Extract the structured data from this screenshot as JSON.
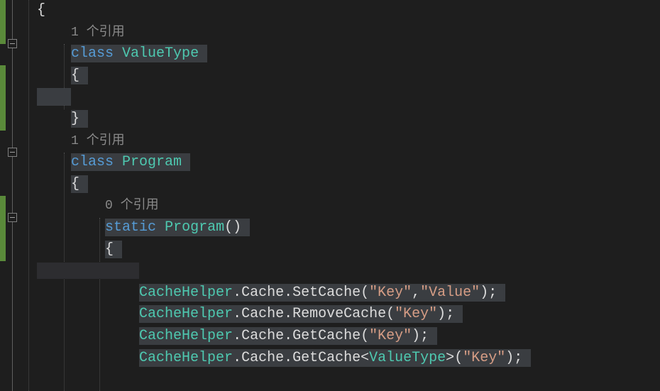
{
  "codelens": {
    "ref1": "1 个引用",
    "ref1b": "1 个引用",
    "ref0": "0 个引用"
  },
  "code": {
    "brace_open": "{",
    "brace_close": "}",
    "class_kw": "class",
    "static_kw": "static",
    "valuetype": "ValueType",
    "program": "Program",
    "paren": "()",
    "cachehelper": "CacheHelper",
    "dot": ".",
    "cache_prop": "Cache",
    "setcache": "SetCache",
    "removecache": "RemoveCache",
    "getcache": "GetCache",
    "key_str": "\"Key\"",
    "value_str": "\"Value\"",
    "comma": ",",
    "lp": "(",
    "rp": ")",
    "semi": ";",
    "lt": "<",
    "gt": ">"
  }
}
